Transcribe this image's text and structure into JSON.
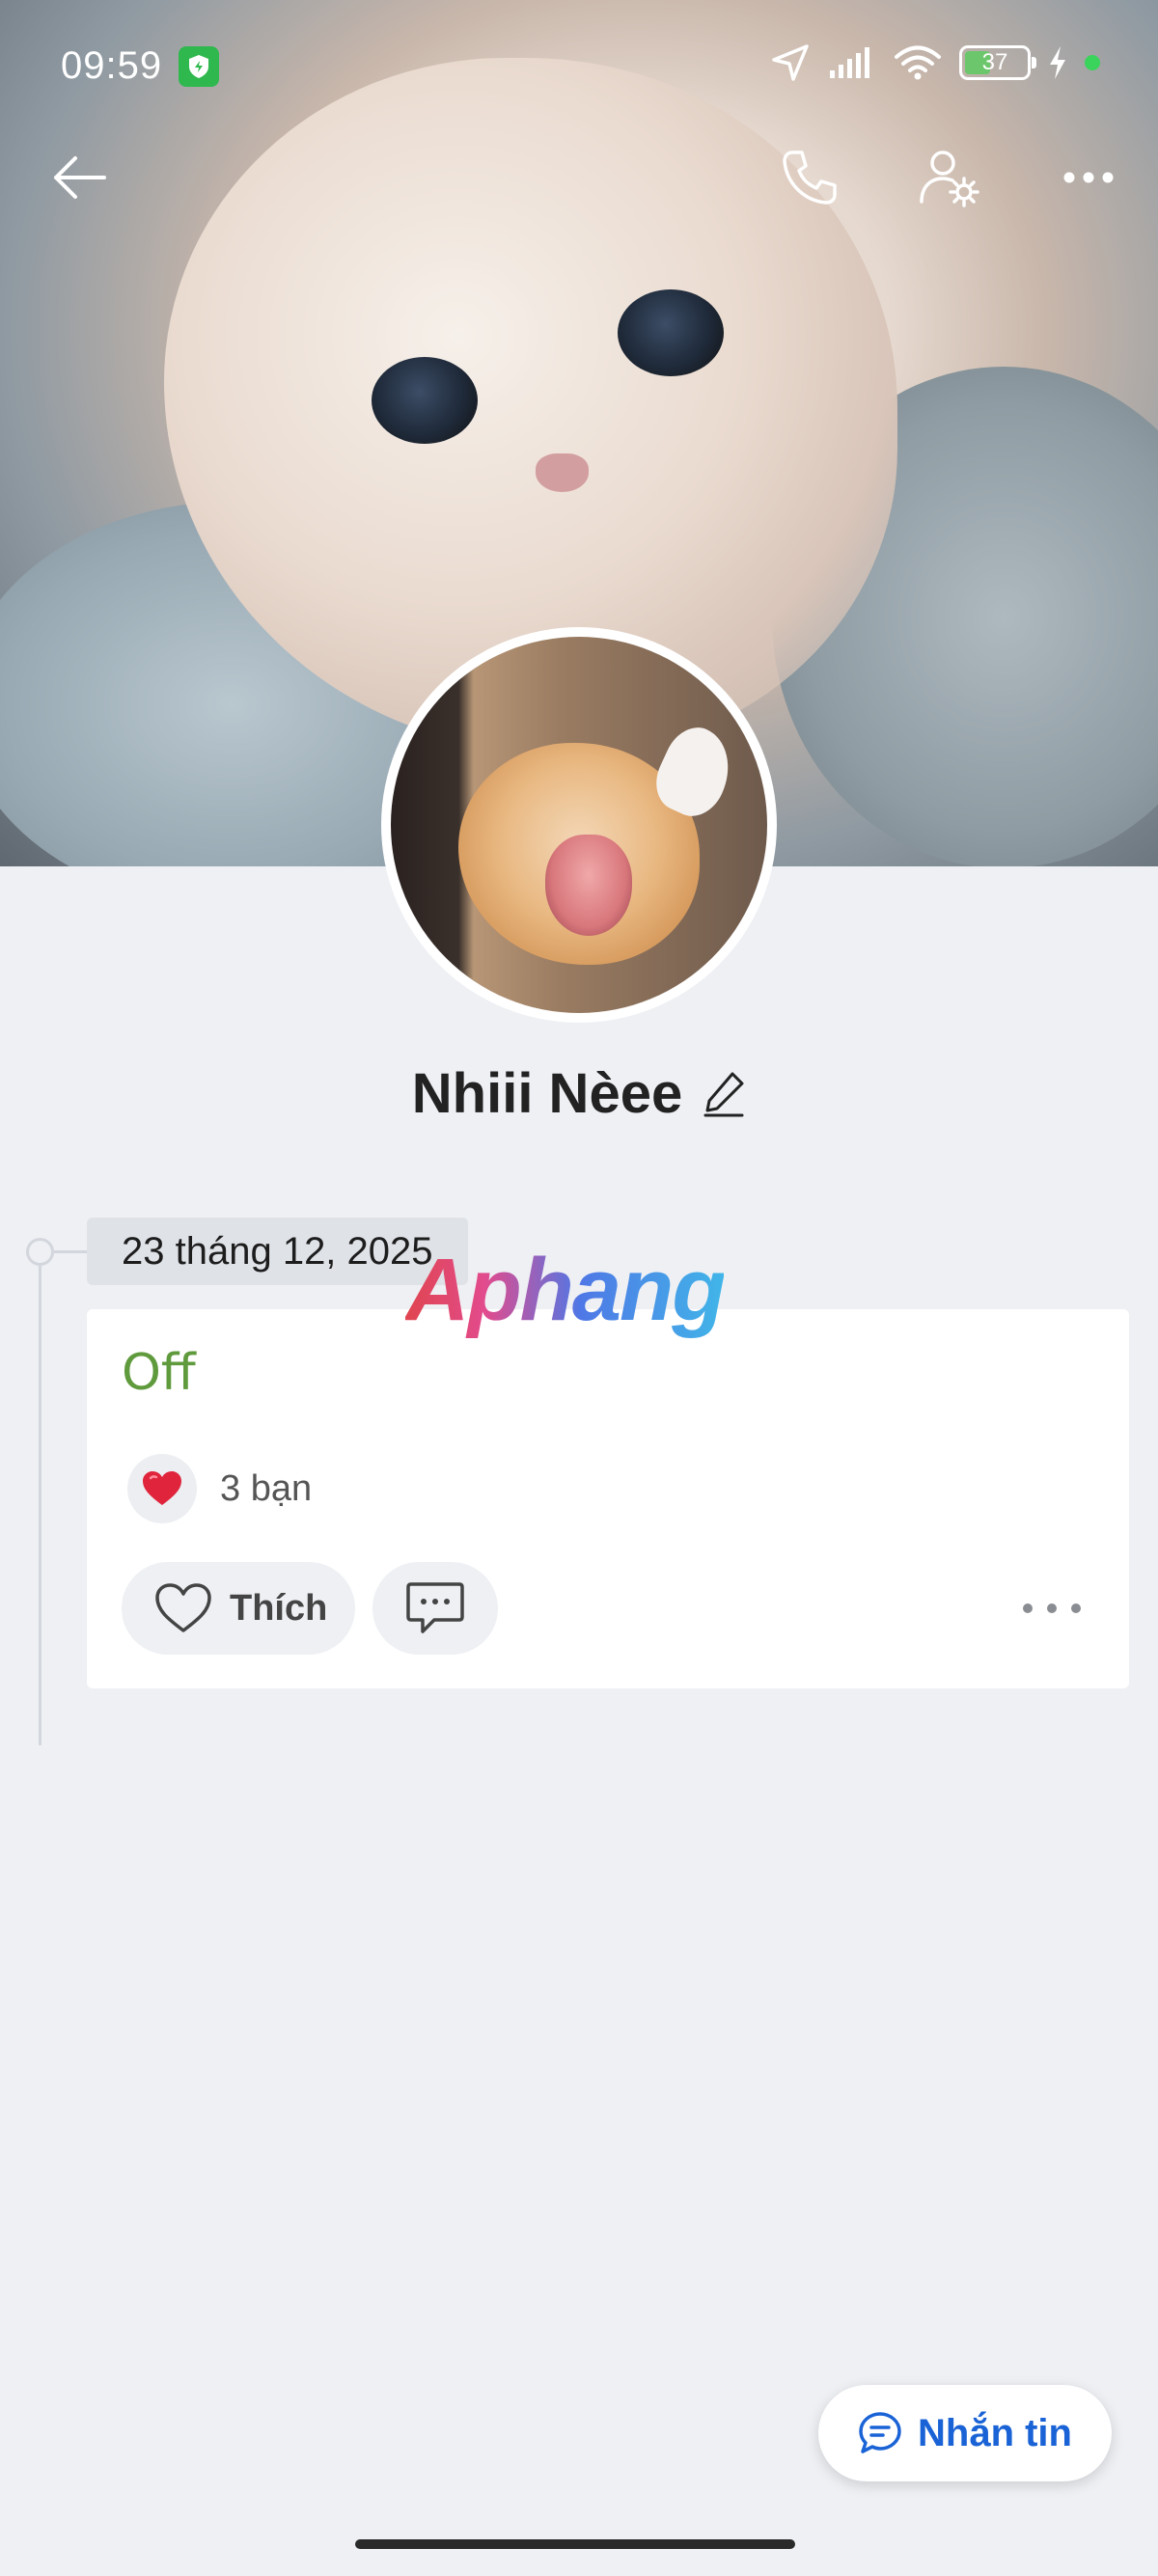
{
  "status_bar": {
    "time": "09:59",
    "battery_level": "37"
  },
  "top_actions": {
    "back_icon": "arrow-left-icon",
    "call_icon": "phone-icon",
    "settings_icon": "user-settings-icon",
    "more_icon": "more-horizontal-icon"
  },
  "profile": {
    "name": "Nhiii Nèee",
    "edit_icon": "pencil-icon"
  },
  "timeline": {
    "date": "23 tháng 12, 2025",
    "watermark": "Aphang",
    "post": {
      "status_text": "Off",
      "reaction_icon": "heart-icon",
      "reaction_count": "3 bạn",
      "like_label": "Thích",
      "comment_icon": "comment-icon",
      "more_icon": "more-horizontal-icon"
    }
  },
  "message_button": {
    "label": "Nhắn tin",
    "icon": "chat-bubble-icon"
  },
  "colors": {
    "accent_blue": "#1a63d6",
    "status_green": "#5f9a3c",
    "heart_red": "#e0243b"
  }
}
